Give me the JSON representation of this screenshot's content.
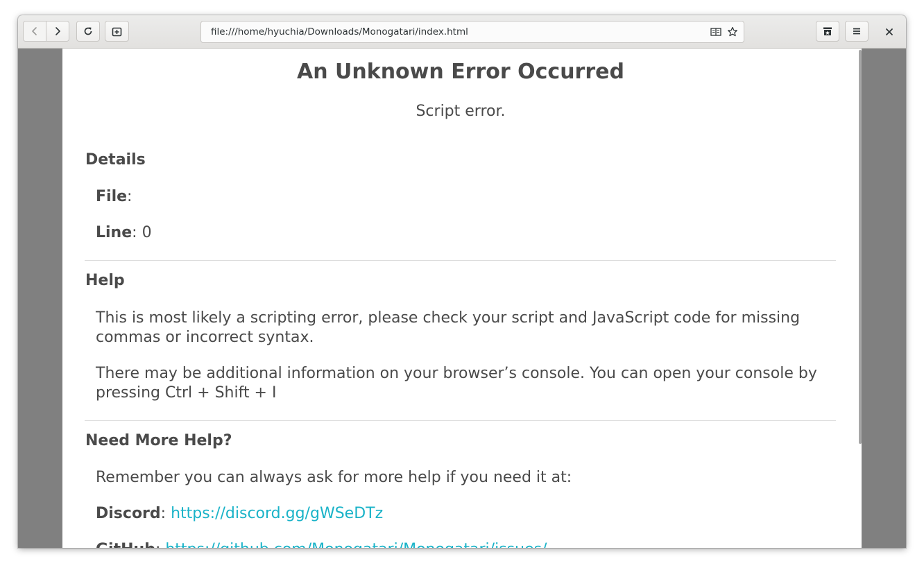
{
  "browser": {
    "url": "file:///home/hyuchia/Downloads/Monogatari/index.html",
    "icons": {
      "back": "chevron-left-icon",
      "forward": "chevron-right-icon",
      "reload": "reload-icon",
      "new_tab": "new-tab-icon",
      "reader": "reader-mode-icon",
      "bookmark": "star-icon",
      "bookmarks_manager": "bookmarks-icon",
      "menu": "hamburger-menu-icon",
      "close": "close-icon"
    }
  },
  "page": {
    "title": "An Unknown Error Occurred",
    "subtitle": "Script error.",
    "details": {
      "heading": "Details",
      "file_label": "File",
      "file_sep": ":",
      "file_value": "",
      "line_label": "Line",
      "line_sep": ": ",
      "line_value": "0"
    },
    "help": {
      "heading": "Help",
      "para1": "This is most likely a scripting error, please check your script and JavaScript code for missing commas or incorrect syntax.",
      "para2": "There may be additional information on your browser’s console. You can open your console by pressing Ctrl + Shift + I"
    },
    "more_help": {
      "heading": "Need More Help?",
      "intro": "Remember you can always ask for more help if you need it at:",
      "discord_label": "Discord",
      "discord_sep": ": ",
      "discord_url": "https://discord.gg/gWSeDTz",
      "github_label": "GitHub",
      "github_sep": ": ",
      "github_url": "https://github.com/Monogatari/Monogatari/issues/"
    }
  },
  "colors": {
    "text": "#4a4a4a",
    "link": "#1ab3c8",
    "window_bg": "#808080"
  }
}
